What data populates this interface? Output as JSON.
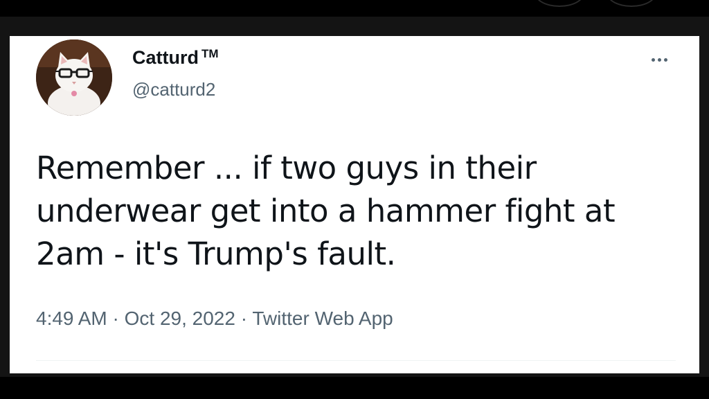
{
  "tweet": {
    "display_name": "Catturd",
    "trademark": "TM",
    "handle": "@catturd2",
    "text_lines": [
      "Remember ... if two guys in their",
      "underwear get into a hammer fight at",
      "2am - it's Trump's fault."
    ],
    "time": "4:49 AM",
    "separator": "·",
    "date": "Oct 29, 2022",
    "source": "Twitter Web App",
    "more_icon": "more-horizontal-icon",
    "avatar_icon": "cat-with-glasses-avatar"
  },
  "colors": {
    "card_background": "#ffffff",
    "primary_text": "#0f1419",
    "secondary_text": "#536471",
    "frame": "#141414",
    "outer": "#000000"
  }
}
